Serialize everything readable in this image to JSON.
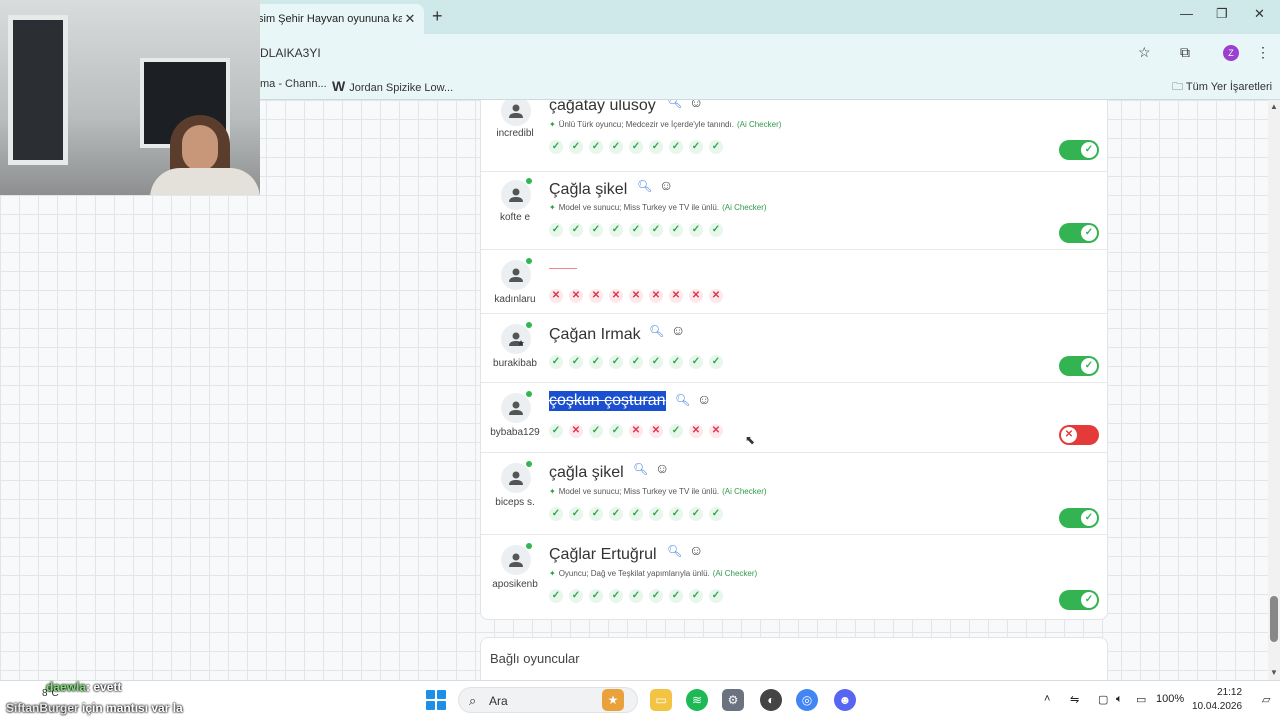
{
  "browser": {
    "tab_title": "sim Şehir Hayvan oyununa kat",
    "tab_close": "✕",
    "new_tab": "+",
    "url": "DLAIKA3YI",
    "bookmarks": [
      {
        "label": "ma - Chann..."
      },
      {
        "label": "Jordan Spizike Low...",
        "badge": "W"
      }
    ],
    "all_bookmarks": "Tüm Yer İşaretleri",
    "profile_initial": "Z"
  },
  "answers": [
    {
      "user": "incredibl",
      "text": "çağatay ulusoy",
      "info": "Ünlü Türk oyuncu; Medcezir ve İçerde'yle tanındı.",
      "ai": "(Ai Checker)",
      "votes": [
        "ok",
        "ok",
        "ok",
        "ok",
        "ok",
        "ok",
        "ok",
        "ok",
        "ok"
      ],
      "valid": true
    },
    {
      "user": "kofte e",
      "text": "Çağla şikel",
      "info": "Model ve sunucu; Miss Turkey ve TV ile ünlü.",
      "ai": "(Ai Checker)",
      "votes": [
        "ok",
        "ok",
        "ok",
        "ok",
        "ok",
        "ok",
        "ok",
        "ok",
        "ok"
      ],
      "valid": true
    },
    {
      "user": "kadınlaru",
      "text": "",
      "info": "",
      "ai": "",
      "votes": [
        "no",
        "no",
        "no",
        "no",
        "no",
        "no",
        "no",
        "no",
        "no"
      ],
      "valid": null
    },
    {
      "user": "burakibab",
      "text": "Çağan Irmak",
      "info": "",
      "ai": "",
      "votes": [
        "ok",
        "ok",
        "ok",
        "ok",
        "ok",
        "ok",
        "ok",
        "ok",
        "ok"
      ],
      "valid": true
    },
    {
      "user": "bybaba129",
      "text": "çoşkun çoşturan",
      "info": "",
      "ai": "",
      "votes": [
        "ok",
        "no",
        "ok",
        "ok",
        "no",
        "no",
        "ok",
        "no",
        "no"
      ],
      "valid": false
    },
    {
      "user": "biceps s.",
      "text": "çağla şikel",
      "info": "Model ve sunucu; Miss Turkey ve TV ile ünlü.",
      "ai": "(Ai Checker)",
      "votes": [
        "ok",
        "ok",
        "ok",
        "ok",
        "ok",
        "ok",
        "ok",
        "ok",
        "ok"
      ],
      "valid": true
    },
    {
      "user": "aposikenb",
      "text": "Çağlar Ertuğrul",
      "info": "Oyuncu; Dağ ve Teşkilat yapımlarıyla ünlü.",
      "ai": "(Ai Checker)",
      "votes": [
        "ok",
        "ok",
        "ok",
        "ok",
        "ok",
        "ok",
        "ok",
        "ok",
        "ok"
      ],
      "valid": true
    }
  ],
  "players_section": "Bağlı oyuncular",
  "chat": [
    {
      "name": "daewla",
      "message": ": evett"
    },
    {
      "name": "SiftanBurger",
      "message": " için mantısı var la"
    }
  ],
  "weather": "8°C",
  "taskbar": {
    "search_placeholder": "Ara",
    "battery": "100%",
    "time": "21:12",
    "date": "10.04.2026"
  }
}
